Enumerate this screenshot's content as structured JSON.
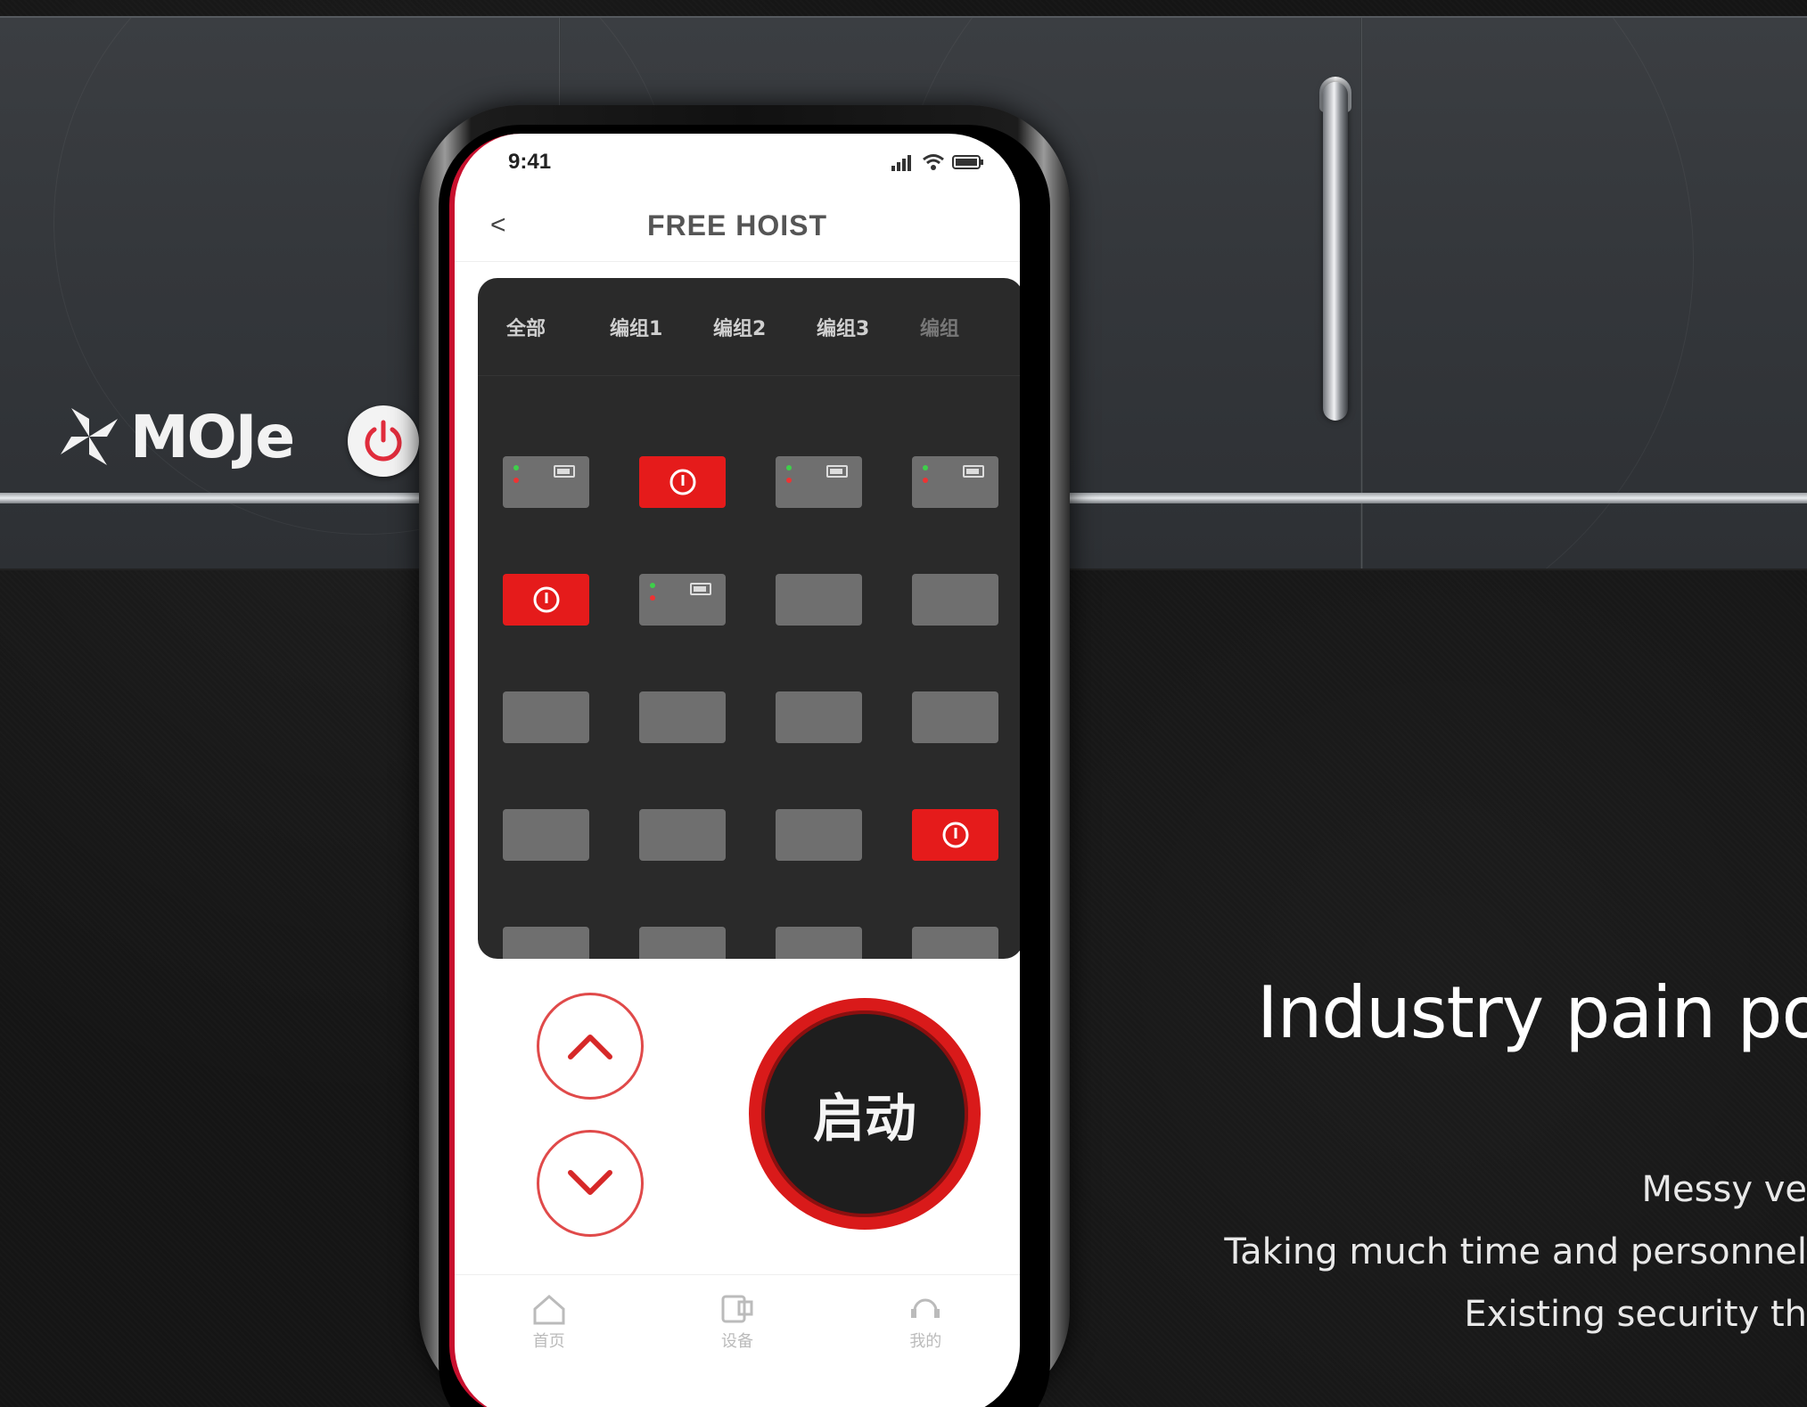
{
  "device": {
    "brand": "MOJe",
    "colors": {
      "housing": "#34373b",
      "stripe": "#e9ecef",
      "accent": "#c8102e"
    },
    "icons": {
      "power": "power-icon"
    }
  },
  "phone": {
    "status": {
      "time": "9:41"
    },
    "nav": {
      "back": "<",
      "title": "FREE HOIST"
    },
    "tabs": [
      "全部",
      "编组1",
      "编组2",
      "编组3",
      "编组"
    ],
    "grid_states": [
      [
        "battery",
        "alarm",
        "battery",
        "battery"
      ],
      [
        "alarm",
        "battery",
        "empty",
        "empty"
      ],
      [
        "empty",
        "empty",
        "empty",
        "empty"
      ],
      [
        "empty",
        "empty",
        "empty",
        "alarm"
      ],
      [
        "empty",
        "empty",
        "empty",
        "empty"
      ]
    ],
    "controls": {
      "start": "启动",
      "up_icon": "chevron-up-icon",
      "down_icon": "chevron-down-icon"
    },
    "tabbar": [
      {
        "label": "首页",
        "icon": "home-icon"
      },
      {
        "label": "设备",
        "icon": "device-icon"
      },
      {
        "label": "我的",
        "icon": "profile-icon"
      }
    ]
  },
  "copy": {
    "headline": "Industry pain poin",
    "points": [
      "Messy ve",
      "Taking much time and personnel",
      "Existing security th"
    ]
  }
}
